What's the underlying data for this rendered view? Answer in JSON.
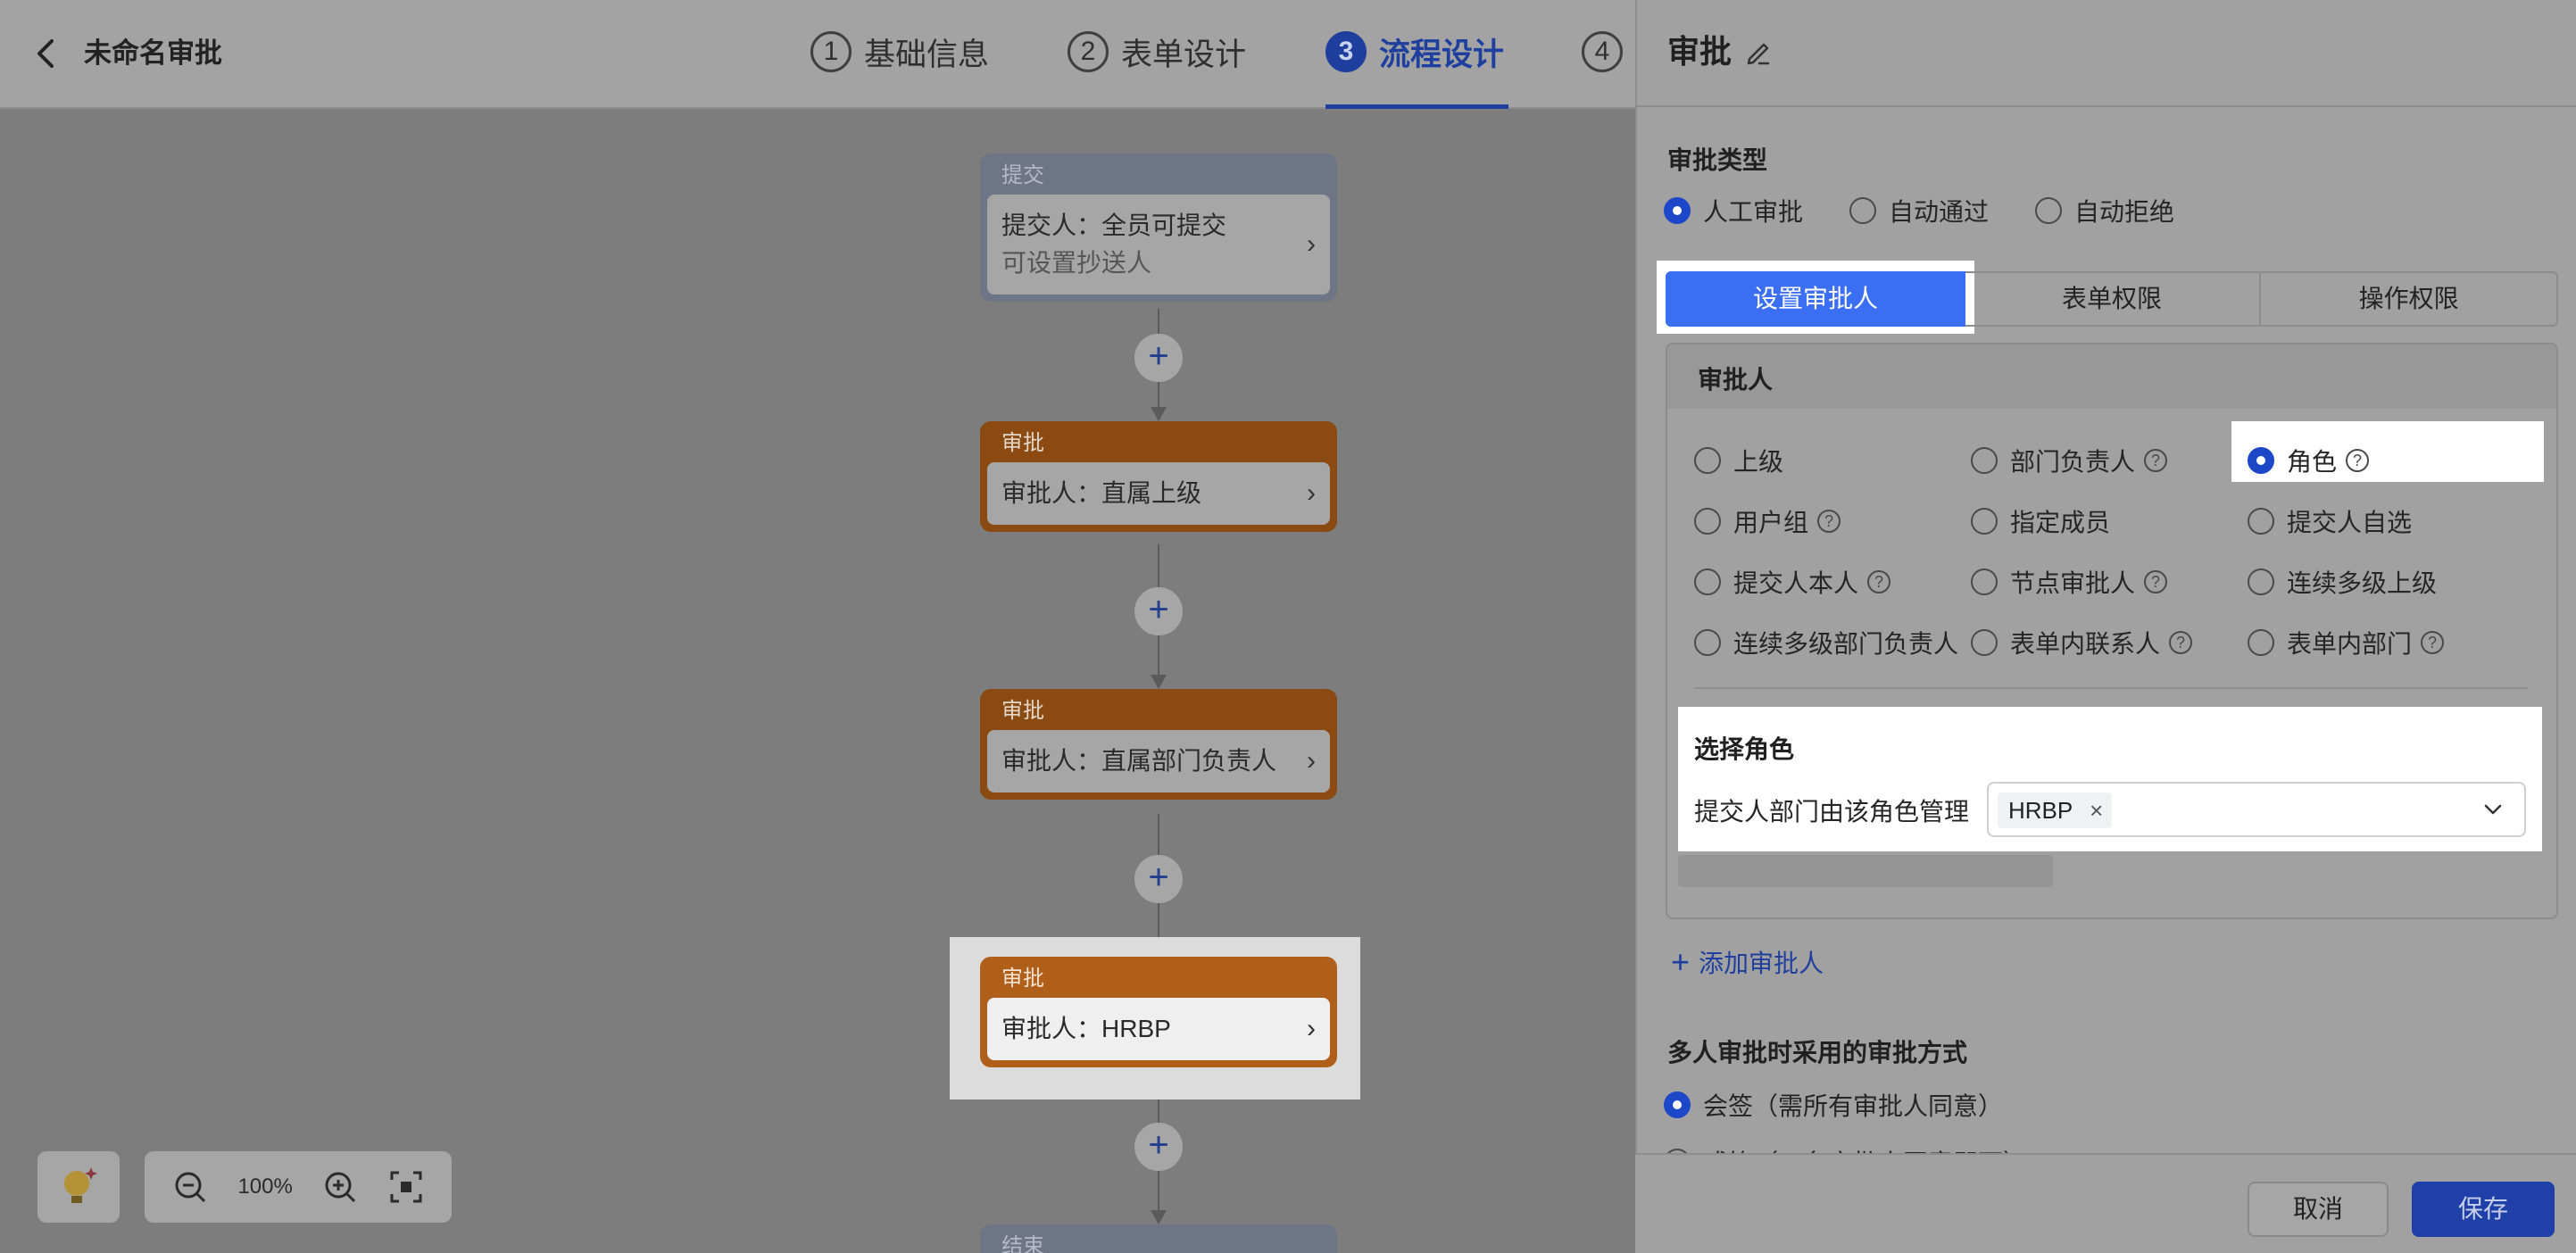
{
  "header": {
    "app_title": "未命名审批",
    "steps": [
      {
        "num": "1",
        "label": "基础信息"
      },
      {
        "num": "2",
        "label": "表单设计"
      },
      {
        "num": "3",
        "label": "流程设计"
      },
      {
        "num": "4",
        "label": ""
      }
    ],
    "active_step": "流程设计"
  },
  "flow": {
    "start": {
      "title": "提交",
      "line1": "提交人：全员可提交",
      "line2": "可设置抄送人"
    },
    "nodes": [
      {
        "title": "审批",
        "text": "审批人：直属上级"
      },
      {
        "title": "审批",
        "text": "审批人：直属部门负责人"
      },
      {
        "title": "审批",
        "text": "审批人：HRBP"
      }
    ],
    "end": {
      "title": "结束"
    },
    "add_symbol": "+"
  },
  "zoom": {
    "level": "100%"
  },
  "drawer": {
    "title": "审批",
    "approval_type": {
      "label": "审批类型",
      "options": [
        "人工审批",
        "自动通过",
        "自动拒绝"
      ],
      "selected": "人工审批"
    },
    "tabs": [
      "设置审批人",
      "表单权限",
      "操作权限"
    ],
    "active_tab": "设置审批人",
    "approver": {
      "title": "审批人",
      "options": [
        "上级",
        "部门负责人",
        "角色",
        "用户组",
        "指定成员",
        "提交人自选",
        "提交人本人",
        "节点审批人",
        "连续多级上级",
        "连续多级部门负责人",
        "表单内联系人",
        "表单内部门"
      ],
      "selected": "角色",
      "help_mark": "?"
    },
    "role": {
      "title": "选择角色",
      "field_label": "提交人部门由该角色管理",
      "selected_tag": "HRBP",
      "tag_remove": "×"
    },
    "add_approver": "添加审批人",
    "multi": {
      "title": "多人审批时采用的审批方式",
      "options": [
        "会签（需所有审批人同意）",
        "或签（一名审批人同意即可）"
      ],
      "selected": "会签（需所有审批人同意）"
    },
    "footer": {
      "cancel": "取消",
      "save": "保存"
    }
  },
  "colors": {
    "accent": "#3b6ff3",
    "approval_node": "#b05f1b",
    "start_node": "#6e7587"
  }
}
